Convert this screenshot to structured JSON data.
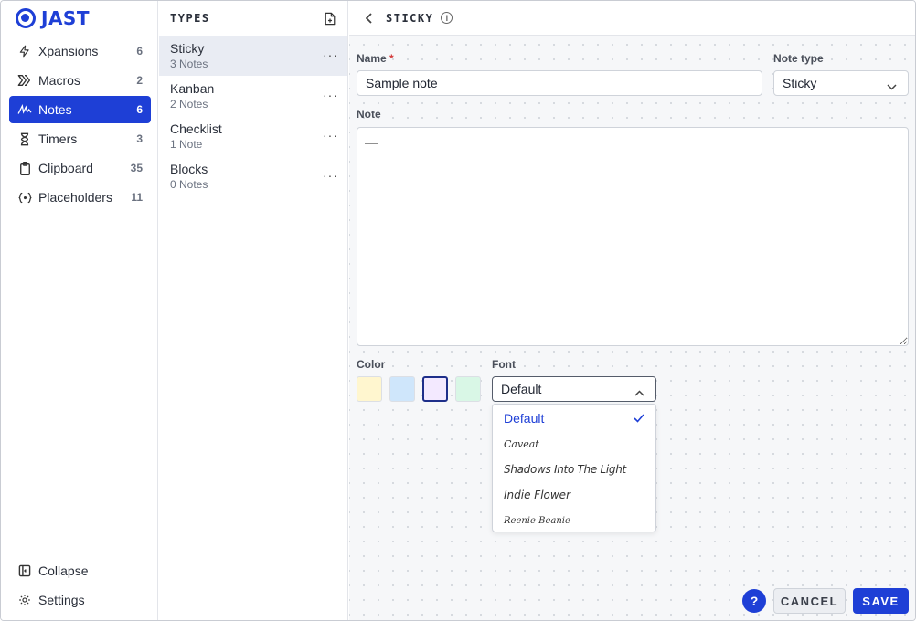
{
  "app": {
    "name": "JAST"
  },
  "sidebar": {
    "items": [
      {
        "label": "Xpansions",
        "count": "6",
        "icon": "bolt-icon"
      },
      {
        "label": "Macros",
        "count": "2",
        "icon": "chevrons-right-icon"
      },
      {
        "label": "Notes",
        "count": "6",
        "icon": "scribble-icon",
        "active": true
      },
      {
        "label": "Timers",
        "count": "3",
        "icon": "hourglass-icon"
      },
      {
        "label": "Clipboard",
        "count": "35",
        "icon": "clipboard-icon"
      },
      {
        "label": "Placeholders",
        "count": "11",
        "icon": "braces-icon"
      }
    ],
    "collapse_label": "Collapse",
    "settings_label": "Settings"
  },
  "types": {
    "title": "TYPES",
    "items": [
      {
        "name": "Sticky",
        "sub": "3 Notes",
        "active": true
      },
      {
        "name": "Kanban",
        "sub": "2 Notes"
      },
      {
        "name": "Checklist",
        "sub": "1 Note"
      },
      {
        "name": "Blocks",
        "sub": "0 Notes"
      }
    ],
    "more_glyph": "···"
  },
  "editor": {
    "title": "STICKY",
    "name_label": "Name",
    "required_mark": "*",
    "name_value": "Sample note",
    "note_type_label": "Note type",
    "note_type_value": "Sticky",
    "note_label": "Note",
    "note_value": "—",
    "color_label": "Color",
    "colors": [
      "#fff6cf",
      "#cfe6fb",
      "#f3e9ff",
      "#d9f7e6"
    ],
    "selected_color_index": 2,
    "font_label": "Font",
    "font_value": "Default",
    "font_options": [
      "Default",
      "Caveat",
      "Shadows Into The Light",
      "Indie Flower",
      "Reenie Beanie"
    ]
  },
  "footer": {
    "help_label": "?",
    "cancel_label": "CANCEL",
    "save_label": "SAVE"
  },
  "theme": {
    "accent": "#1e3fd6"
  }
}
